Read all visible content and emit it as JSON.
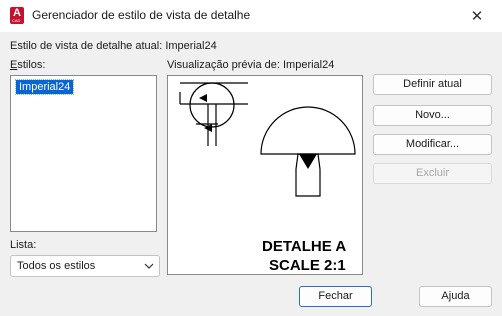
{
  "window": {
    "title": "Gerenciador de estilo de vista de detalhe",
    "icon_letter": "A",
    "icon_caption": "CAD",
    "close_glyph": "✕"
  },
  "current_style": {
    "label": "Estilo de vista de detalhe atual:",
    "value": "Imperial24"
  },
  "styles": {
    "label": "Estilos:",
    "items": [
      "Imperial24"
    ],
    "selected": "Imperial24"
  },
  "preview": {
    "label": "Visualização prévia de:",
    "style_name": "Imperial24",
    "detail_text_line1": "DETALHE A",
    "detail_text_line2": "SCALE 2:1"
  },
  "list_filter": {
    "label": "Lista:",
    "value": "Todos os estilos"
  },
  "buttons": {
    "set_current": "Definir atual",
    "new": "Novo...",
    "modify": "Modificar...",
    "delete": "Excluir",
    "close": "Fechar",
    "help": "Ajuda"
  },
  "colors": {
    "selection": "#0a64d8",
    "accent_border": "#2c6bd0",
    "app_icon": "#c8102e"
  }
}
